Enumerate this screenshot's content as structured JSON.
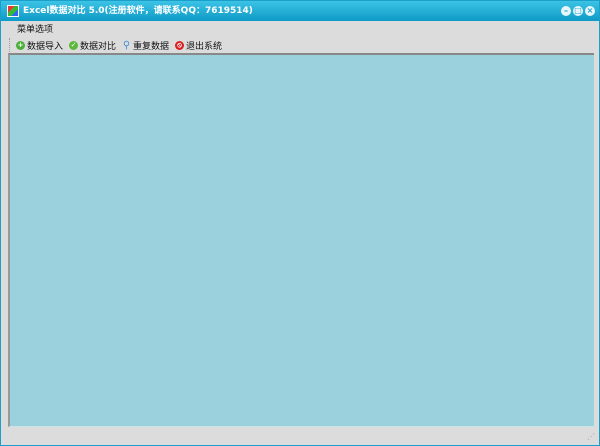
{
  "title": "Excel数据对比  5.0(注册软件，请联系QQ：7619514)",
  "controls": {
    "minimize": "–",
    "maximize": "□",
    "close": "×"
  },
  "menu": {
    "label": "菜单选项"
  },
  "toolbar": [
    {
      "label": "数据导入",
      "icon": "plus-icon",
      "color": "#4caf3a",
      "glyph": "+"
    },
    {
      "label": "数据对比",
      "icon": "check-icon",
      "color": "#5cb83a",
      "glyph": "✓"
    },
    {
      "label": "重复数据",
      "icon": "magnifier-icon",
      "color": "#4a8fd8",
      "glyph": "⚲"
    },
    {
      "label": "退出系统",
      "icon": "stop-icon",
      "color": "#d82020",
      "glyph": "⦸"
    }
  ]
}
